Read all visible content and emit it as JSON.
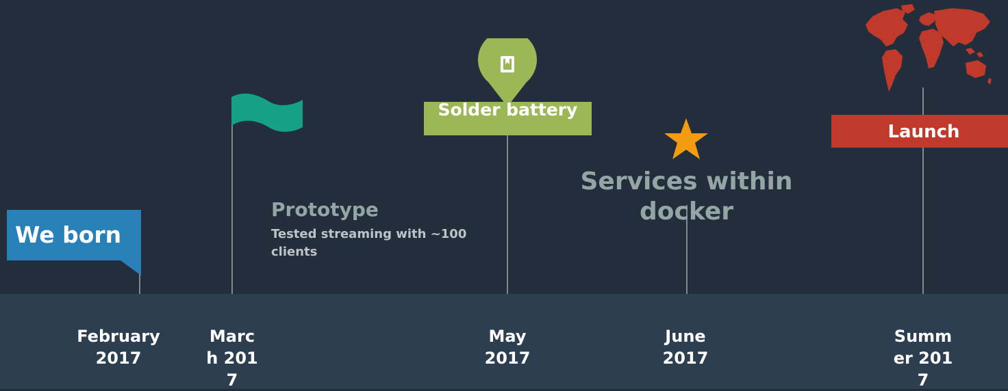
{
  "milestones": {
    "born": {
      "label": "We born",
      "color": "#2980b9"
    },
    "prototype": {
      "title": "Prototype",
      "subtitle": "Tested streaming with ~100 clients",
      "flag_color": "#16a085"
    },
    "solder": {
      "label": "Solder battery",
      "color": "#9cb856",
      "icon": "book-icon"
    },
    "services": {
      "title": "Services within docker",
      "star_color": "#f39c12"
    },
    "launch": {
      "label": "Launch",
      "color": "#c0392b",
      "icon": "world-map-icon"
    }
  },
  "dates": {
    "feb": "February 2017",
    "mar": "March 2017",
    "may": "May 2017",
    "jun": "June 2017",
    "summer": "Summer 2017"
  },
  "colors": {
    "background": "#222e3b",
    "band": "#2c3e50",
    "stem": "#7f8c8d",
    "muted_text": "#95a5a6"
  }
}
